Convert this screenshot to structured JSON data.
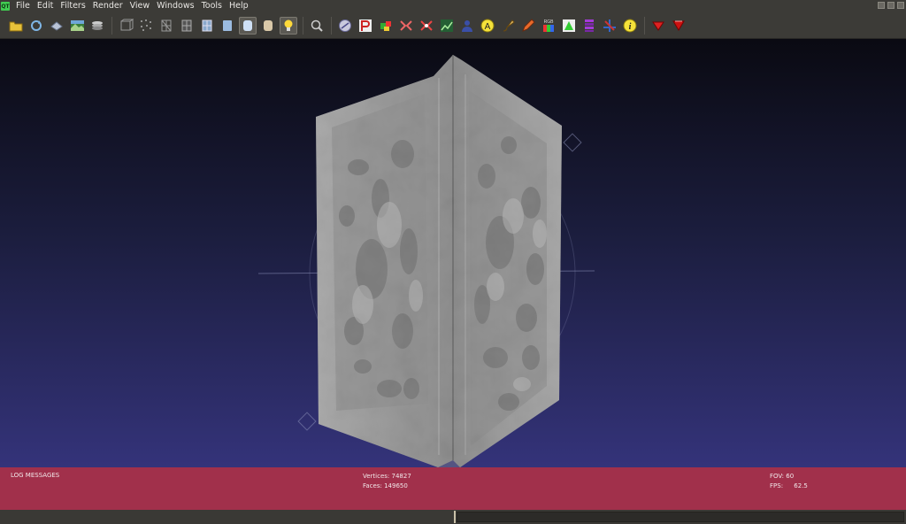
{
  "app": {
    "logo_text": "QT"
  },
  "menu": [
    {
      "label": "File"
    },
    {
      "label": "Edit"
    },
    {
      "label": "Filters"
    },
    {
      "label": "Render"
    },
    {
      "label": "View"
    },
    {
      "label": "Windows"
    },
    {
      "label": "Tools"
    },
    {
      "label": "Help"
    }
  ],
  "toolbar": {
    "groups": [
      [
        "open-folder-icon",
        "reload-icon",
        "save-snapshot-icon",
        "layer-image-icon",
        "layers-stack-icon"
      ],
      [
        "bbox-icon",
        "points-icon",
        "wireframe-icon",
        "hidden-lines-icon",
        "flat-lines-icon",
        "flat-icon",
        "smooth-icon",
        "texture-icon",
        "light-icon"
      ],
      [
        "zoom-icon"
      ],
      [
        "plugin-disk-icon",
        "paint-p-icon",
        "color-cube-icon",
        "align-icon",
        "align-star-icon",
        "chart-icon",
        "person-icon",
        "annotate-a-icon",
        "brush-icon",
        "pencil-icon",
        "rgb-icon",
        "select-tri-icon",
        "measure-bars-icon",
        "axis-icon",
        "info-icon"
      ],
      [
        "select-vertices-icon",
        "select-faces-icon"
      ]
    ],
    "active": [
      "smooth-icon",
      "light-icon"
    ]
  },
  "info": {
    "log_label": "LOG MESSAGES",
    "vertices_label": "Vertices:",
    "vertices": "74827",
    "faces_label": "Faces:",
    "faces": "149650",
    "fov_label": "FOV:",
    "fov": "60",
    "fps_label": "FPS:",
    "fps": "62.5"
  },
  "colors": {
    "menubar": "#3c3b37",
    "viewport_top": "#0a0a12",
    "viewport_bottom": "#34337a",
    "info_bar": "#a1304b",
    "mesh": "#a3a3a3"
  }
}
